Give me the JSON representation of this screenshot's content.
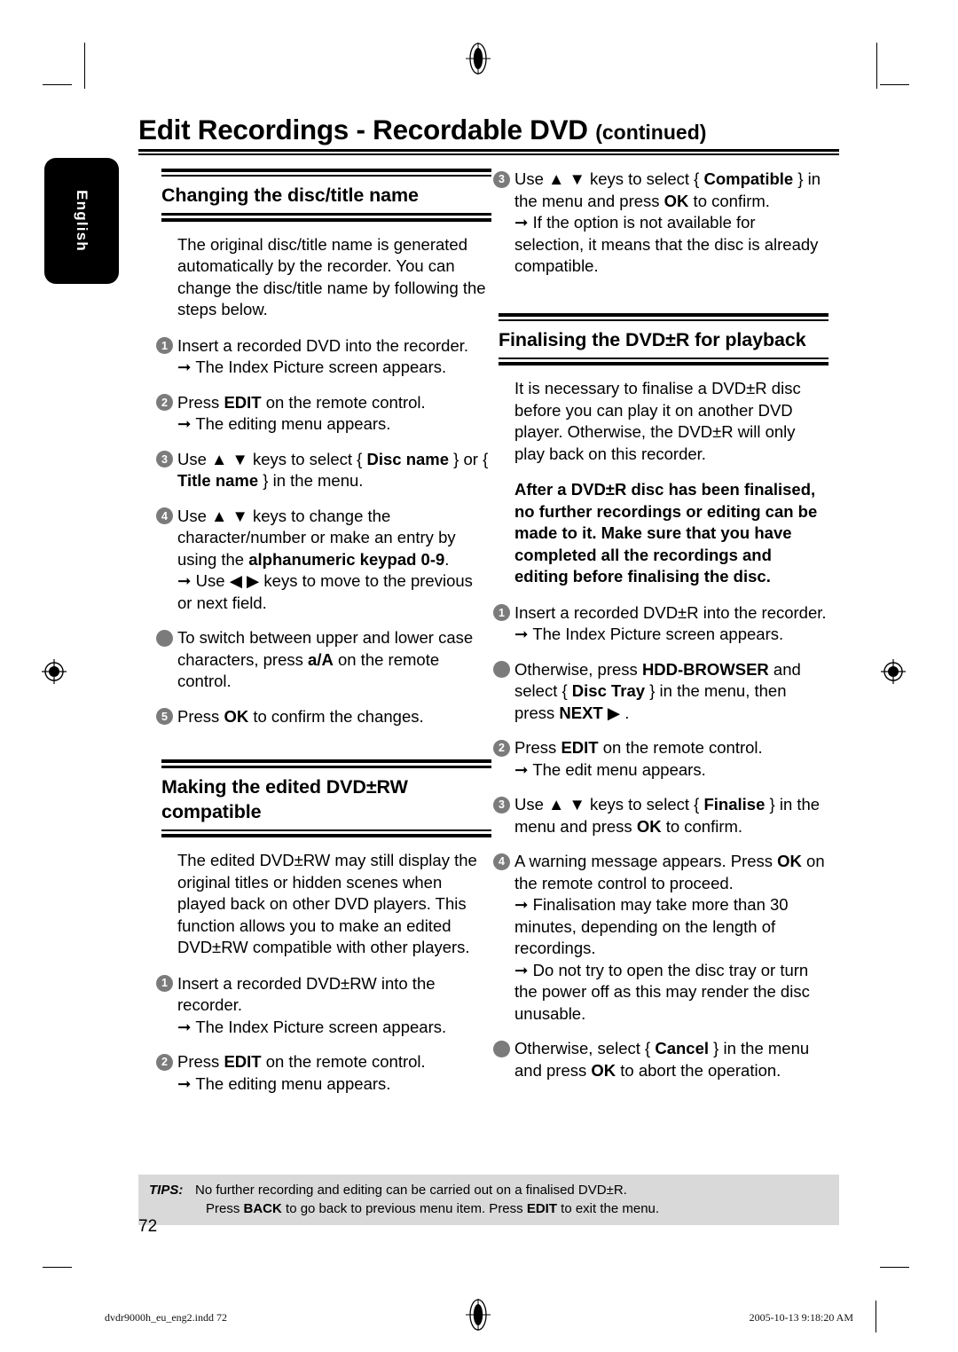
{
  "document": {
    "language_tab": "English",
    "title_main": "Edit Recordings - Recordable DVD",
    "title_suffix": "(continued)",
    "page_number": "72"
  },
  "left_column": {
    "section1": {
      "heading": "Changing the disc/title name",
      "intro": "The original disc/title name is generated automatically by the recorder. You can change the disc/title name by following the steps below.",
      "steps": [
        {
          "marker": "1",
          "type": "number",
          "text": "Insert a recorded DVD into the recorder.",
          "sub": "The Index Picture screen appears."
        },
        {
          "marker": "2",
          "type": "number",
          "text_pre": "Press ",
          "text_key": "EDIT",
          "text_post": " on the remote control.",
          "sub": "The editing menu appears."
        },
        {
          "marker": "3",
          "type": "number",
          "text_pre": "Use ▲ ▼ keys to select { ",
          "text_key": "Disc name",
          "text_mid": " } or { ",
          "text_key2": "Title name",
          "text_post": " } in the menu."
        },
        {
          "marker": "4",
          "type": "number",
          "text_pre": "Use ▲ ▼ keys to change the character/number or make an entry by using the ",
          "text_key": "alphanumeric keypad 0-9",
          "text_post": ".",
          "sub": "Use ◀ ▶ keys to move to the previous or next field."
        },
        {
          "marker": "●",
          "type": "bullet",
          "text_pre": "To switch between upper and lower case characters, press ",
          "text_key": "a/A",
          "text_post": " on the remote control."
        },
        {
          "marker": "5",
          "type": "number",
          "text_pre": "Press ",
          "text_key": "OK",
          "text_post": " to confirm the changes."
        }
      ]
    },
    "section2": {
      "heading": "Making the edited DVD±RW compatible",
      "intro": "The edited DVD±RW may still display the original titles or hidden scenes when played back on other DVD players. This function allows you to make an edited DVD±RW compatible with other players.",
      "steps": [
        {
          "marker": "1",
          "type": "number",
          "text": "Insert a recorded DVD±RW into the recorder.",
          "sub": "The Index Picture screen appears."
        },
        {
          "marker": "2",
          "type": "number",
          "text_pre": "Press ",
          "text_key": "EDIT",
          "text_post": " on the remote control.",
          "sub": "The editing menu appears."
        }
      ]
    }
  },
  "right_column": {
    "continued_step": {
      "marker": "3",
      "type": "number",
      "text_pre": "Use ▲ ▼ keys to select { ",
      "text_key": "Compatible",
      "text_mid": " } in the menu and press ",
      "text_key2": "OK",
      "text_post": " to confirm.",
      "sub": "If the option is not available for selection, it means that the disc is already compatible."
    },
    "section3": {
      "heading": "Finalising the DVD±R for playback",
      "intro": "It is necessary to finalise a DVD±R disc before you can play it on another DVD player. Otherwise, the DVD±R will only play back on this recorder.",
      "warning": "After a DVD±R disc has been finalised, no further recordings or editing can be made to it. Make sure that you have completed all the recordings and editing before finalising the disc.",
      "steps": [
        {
          "marker": "1",
          "type": "number",
          "text": "Insert a recorded DVD±R into the recorder.",
          "sub": "The Index Picture screen appears."
        },
        {
          "marker": "●",
          "type": "bullet",
          "text_pre": "Otherwise, press ",
          "text_key": "HDD-BROWSER",
          "text_mid": " and select { ",
          "text_key2": "Disc Tray",
          "text_mid2": " } in the menu, then press ",
          "text_key3": "NEXT ▶",
          "text_post": " ."
        },
        {
          "marker": "2",
          "type": "number",
          "text_pre": "Press ",
          "text_key": "EDIT",
          "text_post": " on the remote control.",
          "sub": "The edit menu appears."
        },
        {
          "marker": "3",
          "type": "number",
          "text_pre": "Use ▲ ▼ keys to select { ",
          "text_key": "Finalise",
          "text_mid": " } in the menu and press ",
          "text_key2": "OK",
          "text_post": " to confirm."
        },
        {
          "marker": "4",
          "type": "number",
          "text_pre": "A warning message appears. Press ",
          "text_key": "OK",
          "text_post": " on the remote control to proceed.",
          "sub": "Finalisation may take more than 30 minutes, depending on the length of recordings.",
          "sub2": "Do not try to open the disc tray or turn the power off as this may render the disc unusable."
        },
        {
          "marker": "●",
          "type": "bullet",
          "text_pre": "Otherwise, select { ",
          "text_key": "Cancel",
          "text_mid": " } in the menu and press ",
          "text_key2": "OK",
          "text_post": " to abort the operation."
        }
      ]
    }
  },
  "tips": {
    "label": "TIPS:",
    "line1": "No further recording and editing can be carried out on a finalised DVD±R.",
    "line2_pre": "Press ",
    "line2_key1": "BACK",
    "line2_mid": " to go back to previous menu item. Press ",
    "line2_key2": "EDIT",
    "line2_post": " to exit the menu."
  },
  "footer": {
    "file_slug": "dvdr9000h_eu_eng2.indd   72",
    "timestamp": "2005-10-13   9:18:20 AM"
  },
  "colors": {
    "marker_gray": "#7b7b7b",
    "tips_background": "#d9d9d9",
    "tab_background": "#000000",
    "text": "#000000"
  }
}
